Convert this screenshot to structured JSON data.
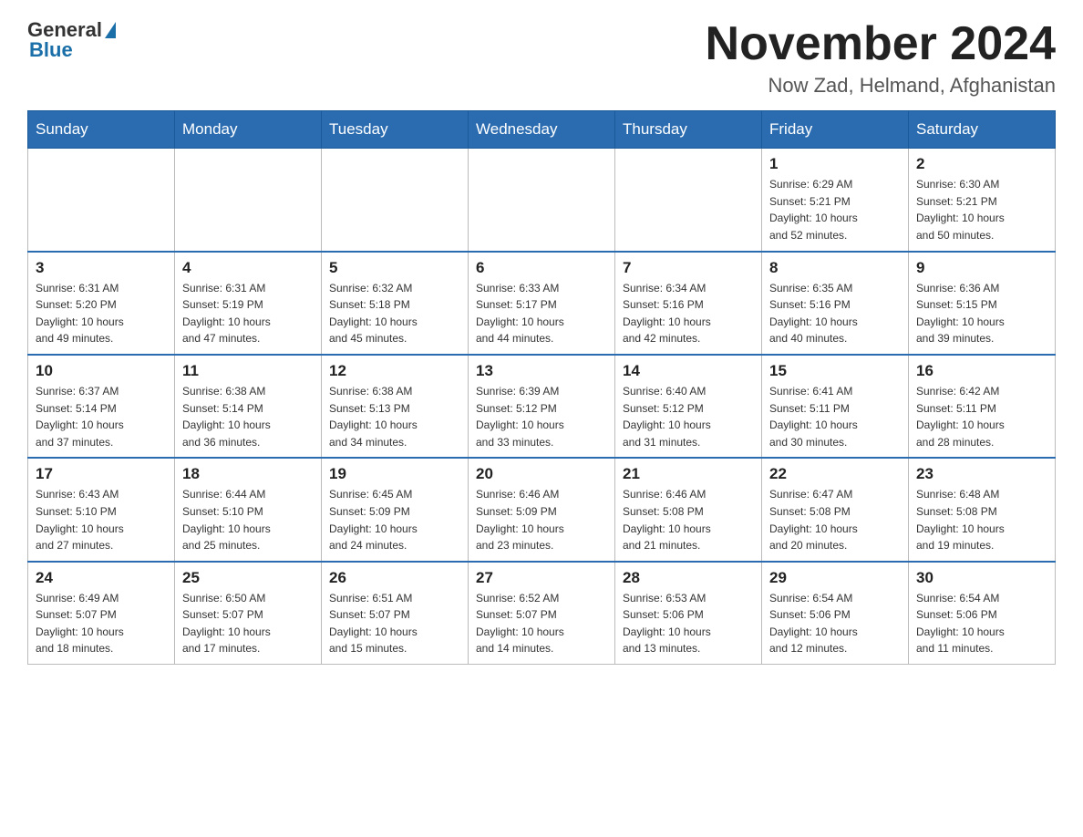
{
  "logo": {
    "general": "General",
    "blue": "Blue"
  },
  "title": "November 2024",
  "location": "Now Zad, Helmand, Afghanistan",
  "days_of_week": [
    "Sunday",
    "Monday",
    "Tuesday",
    "Wednesday",
    "Thursday",
    "Friday",
    "Saturday"
  ],
  "weeks": [
    [
      {
        "day": "",
        "info": ""
      },
      {
        "day": "",
        "info": ""
      },
      {
        "day": "",
        "info": ""
      },
      {
        "day": "",
        "info": ""
      },
      {
        "day": "",
        "info": ""
      },
      {
        "day": "1",
        "info": "Sunrise: 6:29 AM\nSunset: 5:21 PM\nDaylight: 10 hours\nand 52 minutes."
      },
      {
        "day": "2",
        "info": "Sunrise: 6:30 AM\nSunset: 5:21 PM\nDaylight: 10 hours\nand 50 minutes."
      }
    ],
    [
      {
        "day": "3",
        "info": "Sunrise: 6:31 AM\nSunset: 5:20 PM\nDaylight: 10 hours\nand 49 minutes."
      },
      {
        "day": "4",
        "info": "Sunrise: 6:31 AM\nSunset: 5:19 PM\nDaylight: 10 hours\nand 47 minutes."
      },
      {
        "day": "5",
        "info": "Sunrise: 6:32 AM\nSunset: 5:18 PM\nDaylight: 10 hours\nand 45 minutes."
      },
      {
        "day": "6",
        "info": "Sunrise: 6:33 AM\nSunset: 5:17 PM\nDaylight: 10 hours\nand 44 minutes."
      },
      {
        "day": "7",
        "info": "Sunrise: 6:34 AM\nSunset: 5:16 PM\nDaylight: 10 hours\nand 42 minutes."
      },
      {
        "day": "8",
        "info": "Sunrise: 6:35 AM\nSunset: 5:16 PM\nDaylight: 10 hours\nand 40 minutes."
      },
      {
        "day": "9",
        "info": "Sunrise: 6:36 AM\nSunset: 5:15 PM\nDaylight: 10 hours\nand 39 minutes."
      }
    ],
    [
      {
        "day": "10",
        "info": "Sunrise: 6:37 AM\nSunset: 5:14 PM\nDaylight: 10 hours\nand 37 minutes."
      },
      {
        "day": "11",
        "info": "Sunrise: 6:38 AM\nSunset: 5:14 PM\nDaylight: 10 hours\nand 36 minutes."
      },
      {
        "day": "12",
        "info": "Sunrise: 6:38 AM\nSunset: 5:13 PM\nDaylight: 10 hours\nand 34 minutes."
      },
      {
        "day": "13",
        "info": "Sunrise: 6:39 AM\nSunset: 5:12 PM\nDaylight: 10 hours\nand 33 minutes."
      },
      {
        "day": "14",
        "info": "Sunrise: 6:40 AM\nSunset: 5:12 PM\nDaylight: 10 hours\nand 31 minutes."
      },
      {
        "day": "15",
        "info": "Sunrise: 6:41 AM\nSunset: 5:11 PM\nDaylight: 10 hours\nand 30 minutes."
      },
      {
        "day": "16",
        "info": "Sunrise: 6:42 AM\nSunset: 5:11 PM\nDaylight: 10 hours\nand 28 minutes."
      }
    ],
    [
      {
        "day": "17",
        "info": "Sunrise: 6:43 AM\nSunset: 5:10 PM\nDaylight: 10 hours\nand 27 minutes."
      },
      {
        "day": "18",
        "info": "Sunrise: 6:44 AM\nSunset: 5:10 PM\nDaylight: 10 hours\nand 25 minutes."
      },
      {
        "day": "19",
        "info": "Sunrise: 6:45 AM\nSunset: 5:09 PM\nDaylight: 10 hours\nand 24 minutes."
      },
      {
        "day": "20",
        "info": "Sunrise: 6:46 AM\nSunset: 5:09 PM\nDaylight: 10 hours\nand 23 minutes."
      },
      {
        "day": "21",
        "info": "Sunrise: 6:46 AM\nSunset: 5:08 PM\nDaylight: 10 hours\nand 21 minutes."
      },
      {
        "day": "22",
        "info": "Sunrise: 6:47 AM\nSunset: 5:08 PM\nDaylight: 10 hours\nand 20 minutes."
      },
      {
        "day": "23",
        "info": "Sunrise: 6:48 AM\nSunset: 5:08 PM\nDaylight: 10 hours\nand 19 minutes."
      }
    ],
    [
      {
        "day": "24",
        "info": "Sunrise: 6:49 AM\nSunset: 5:07 PM\nDaylight: 10 hours\nand 18 minutes."
      },
      {
        "day": "25",
        "info": "Sunrise: 6:50 AM\nSunset: 5:07 PM\nDaylight: 10 hours\nand 17 minutes."
      },
      {
        "day": "26",
        "info": "Sunrise: 6:51 AM\nSunset: 5:07 PM\nDaylight: 10 hours\nand 15 minutes."
      },
      {
        "day": "27",
        "info": "Sunrise: 6:52 AM\nSunset: 5:07 PM\nDaylight: 10 hours\nand 14 minutes."
      },
      {
        "day": "28",
        "info": "Sunrise: 6:53 AM\nSunset: 5:06 PM\nDaylight: 10 hours\nand 13 minutes."
      },
      {
        "day": "29",
        "info": "Sunrise: 6:54 AM\nSunset: 5:06 PM\nDaylight: 10 hours\nand 12 minutes."
      },
      {
        "day": "30",
        "info": "Sunrise: 6:54 AM\nSunset: 5:06 PM\nDaylight: 10 hours\nand 11 minutes."
      }
    ]
  ]
}
